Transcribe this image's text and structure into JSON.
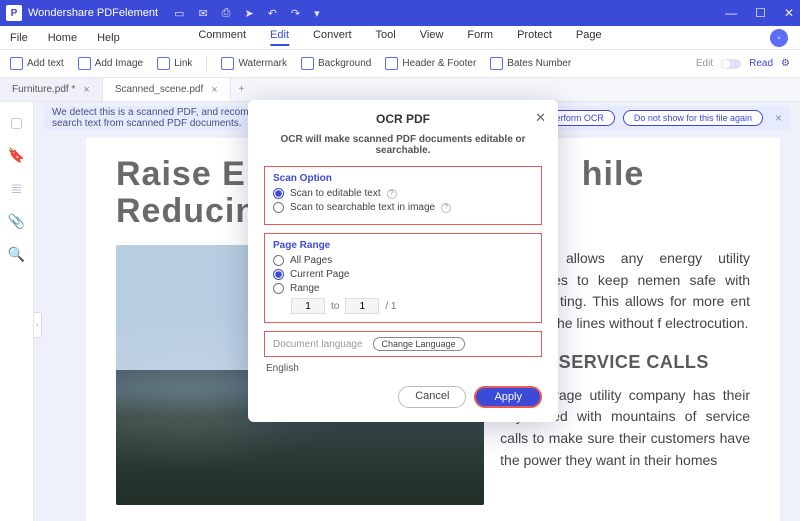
{
  "app": {
    "title": "Wondershare PDFelement"
  },
  "menu": {
    "left": [
      "File",
      "Home",
      "Help"
    ],
    "center": [
      "Comment",
      "Edit",
      "Convert",
      "Tool",
      "View",
      "Form",
      "Protect",
      "Page"
    ],
    "active_index": 1
  },
  "toolbar": {
    "items": [
      "Add text",
      "Add Image",
      "Link",
      "Watermark",
      "Background",
      "Header & Footer",
      "Bates Number"
    ],
    "edit_label": "Edit",
    "read_label": "Read"
  },
  "tabs": [
    {
      "label": "Furniture.pdf *",
      "active": false
    },
    {
      "label": "Scanned_scene.pdf",
      "active": true
    }
  ],
  "banner": {
    "message": "We detect this is a scanned PDF, and recommend you perform OCR, which enables you to copy, edit and search text from scanned PDF documents.",
    "perform": "Perform OCR",
    "dismiss": "Do not show for this file again"
  },
  "doc": {
    "heading_line1": "Raise Ener",
    "heading_line1b": "hile",
    "heading_line2": "Reducing (",
    "para1": "element allows any energy utility companies to keep nemen safe with accurate ting. This allows for more ent work on the lines without f electrocution.",
    "sub": "ROVE SERVICE CALLS",
    "para2": "The average utility company has their days filled with mountains of service calls to make sure their customers have the power they want in their homes"
  },
  "dialog": {
    "title": "OCR PDF",
    "desc": "OCR will make scanned PDF documents editable or searchable.",
    "scan_label": "Scan Option",
    "scan_opt1": "Scan to editable text",
    "scan_opt2": "Scan to searchable text in image",
    "range_label": "Page Range",
    "range_all": "All Pages",
    "range_current": "Current Page",
    "range_range": "Range",
    "range_from": "1",
    "range_to_label": "to",
    "range_to": "1",
    "range_total": "/ 1",
    "lang_label": "Document language",
    "lang_change": "Change Language",
    "lang_value": "English",
    "cancel": "Cancel",
    "apply": "Apply"
  }
}
